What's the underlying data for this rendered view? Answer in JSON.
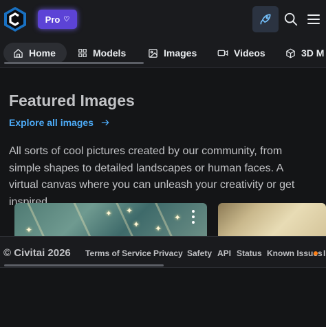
{
  "header": {
    "pro_label": "Pro",
    "icons": {
      "logo": "civitai-logo",
      "pro": "diamond-icon",
      "create": "rocket-icon",
      "search": "search-icon",
      "menu": "menu-icon"
    }
  },
  "tabs": [
    {
      "label": "Home",
      "icon": "home-icon",
      "active": true
    },
    {
      "label": "Models",
      "icon": "grid-icon",
      "active": false
    },
    {
      "label": "Images",
      "icon": "image-icon",
      "active": false
    },
    {
      "label": "Videos",
      "icon": "video-icon",
      "active": false
    },
    {
      "label": "3D M",
      "icon": "cube-icon",
      "active": false
    }
  ],
  "section": {
    "title": "Featured Images",
    "explore_label": "Explore all images",
    "description": "All sorts of cool pictures created by our community, from simple shapes to detailed landscapes or human faces. A virtual canvas where you can unleash your creativity or get inspired."
  },
  "footer": {
    "copyright": "© Civitai 2026",
    "links": [
      "Terms of Service",
      "Privacy",
      "Safety",
      "API",
      "Status",
      "Known Issues",
      "I"
    ]
  },
  "colors": {
    "background": "#141517",
    "header_bg": "#1a1b1e",
    "accent_link": "#4dabf7",
    "pro_purple": "#5c43d6",
    "status_dot": "#fd7e14"
  }
}
